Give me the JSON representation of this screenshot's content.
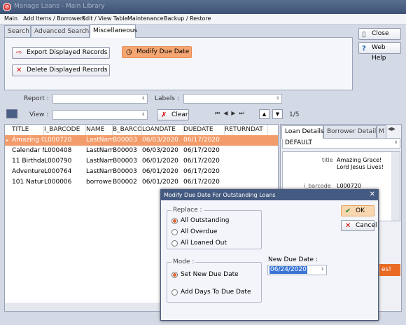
{
  "window": {
    "title": "Manage Loans - Main Library"
  },
  "menu": [
    "Main",
    "Add Items / Borrowers",
    "Edit / View Table",
    "Maintenance",
    "Backup / Restore"
  ],
  "tabs": [
    "Search",
    "Advanced Search",
    "Miscellaneous"
  ],
  "panel": {
    "export": "Export Displayed Records",
    "delete": "Delete Displayed Records",
    "modify": "Modify Due Date"
  },
  "side": {
    "close": "Close",
    "help": "Web Help"
  },
  "filter": {
    "report": "Report :",
    "labels": "Labels :",
    "view": "View :",
    "clear": "Clear",
    "pages": "1/5"
  },
  "grid": {
    "headers": [
      "TITLE",
      "I_BARCODE",
      "NAME",
      "B_BARCO",
      "LOANDATE",
      "DUEDATE",
      "RETURNDAT"
    ],
    "rows": [
      [
        "Amazing G",
        "L000720",
        "LastNam",
        "B00003",
        "06/03/2020",
        "06/17/2020",
        ""
      ],
      [
        "Calendar M",
        "L000408",
        "LastNam",
        "B00003",
        "06/03/2020",
        "06/17/2020",
        ""
      ],
      [
        "11 Birthda",
        "L000790",
        "LastNam",
        "B00003",
        "06/01/2020",
        "06/17/2020",
        ""
      ],
      [
        "Adventure",
        "L000764",
        "LastNam",
        "B00003",
        "06/01/2020",
        "06/17/2020",
        ""
      ],
      [
        "101 Natur",
        "L000006",
        "borrowe",
        "B00002",
        "06/01/2020",
        "06/17/2020",
        ""
      ]
    ]
  },
  "details": {
    "tabs": [
      "Loan Details",
      "Borrower Details",
      "M"
    ],
    "layout": "DEFAULT",
    "title_label": "title",
    "title_value": "Amazing Grace! Lord Jesus Lives!",
    "barcode_label": "i_barcode",
    "barcode_value": "L000720",
    "es": "es!"
  },
  "dialog": {
    "title": "Modify Due Date For Outstanding Loans",
    "replace": "Replace :",
    "r1": "All Outstanding",
    "r2": "All Overdue",
    "r3": "All Loaned Out",
    "mode": "Mode :",
    "m1": "Set New Due Date",
    "m2": "Add Days To Due Date",
    "new_due_label": "New Due Date :",
    "new_due": "06/24/2020",
    "ok": "OK",
    "cancel": "Cancel"
  }
}
